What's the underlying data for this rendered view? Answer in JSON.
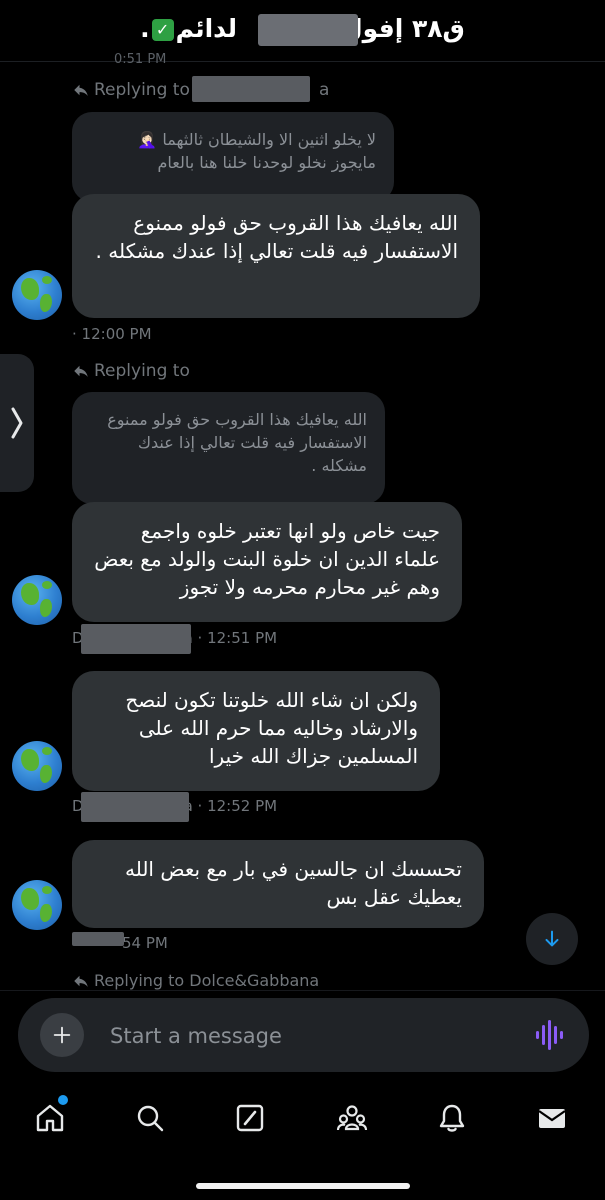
{
  "header": {
    "title_prefix": "ق٣٨ إفول",
    "title_suffix": "لدائم",
    "check_emoji": "✓",
    "trailing": "."
  },
  "thread": {
    "faded_time": "0:51 PM",
    "reply_prefix": "Replying to",
    "reply_1_name": "D",
    "reply_1_tail": "a",
    "quote_1": "لا يخلو اثنين الا والشيطان ثالثهما 🤦🏻‍♀️\nمايجوز نخلو لوحدنا خلنا هنا بالعام",
    "message_1": "الله يعافيك هذا القروب حق فولو ممنوع الاستفسار فيه قلت تعالي إذا عندك مشكله .",
    "time_1": "12:00 PM",
    "reply_2_name": "",
    "quote_2": "الله يعافيك هذا القروب حق فولو ممنوع الاستفسار فيه قلت تعالي إذا عندك مشكله .",
    "message_2": "جيت خاص ولو انها تعتبر خلوه واجمع علماء الدين ان خلوة البنت والولد مع بعض وهم غير محارم محرمه ولا تجوز",
    "sender_2_initial": "D",
    "sender_2_tail": "a",
    "time_2": "12:51 PM",
    "message_3": "ولكن ان شاء الله خلوتنا تكون لنصح والارشاد وخاليه مما حرم الله على المسلمين جزاك الله خيرا",
    "sender_3_initial": "D",
    "sender_3_tail": "a",
    "time_3": "12:52 PM",
    "message_4": "تحسسك ان جالسين في بار مع بعض الله يعطيك عقل بس",
    "time_4": "54 PM",
    "reply_last": "Replying to Dolce&Gabbana"
  },
  "composer": {
    "placeholder": "Start a message"
  },
  "icons": {
    "reply": "reply-arrow-icon",
    "globe": "globe-emoji-icon",
    "side": "chevron-right-icon",
    "scroll": "arrow-down-icon",
    "add": "plus-icon",
    "voice": "voice-wave-icon",
    "home": "home-icon",
    "search": "search-icon",
    "grok": "grok-icon",
    "communities": "communities-icon",
    "notifications": "bell-icon",
    "messages": "envelope-icon"
  },
  "colors": {
    "accent": "#1d9bf0",
    "voice": "#8b5cf6",
    "bubble": "#2f3336",
    "quote": "#1f2226"
  }
}
